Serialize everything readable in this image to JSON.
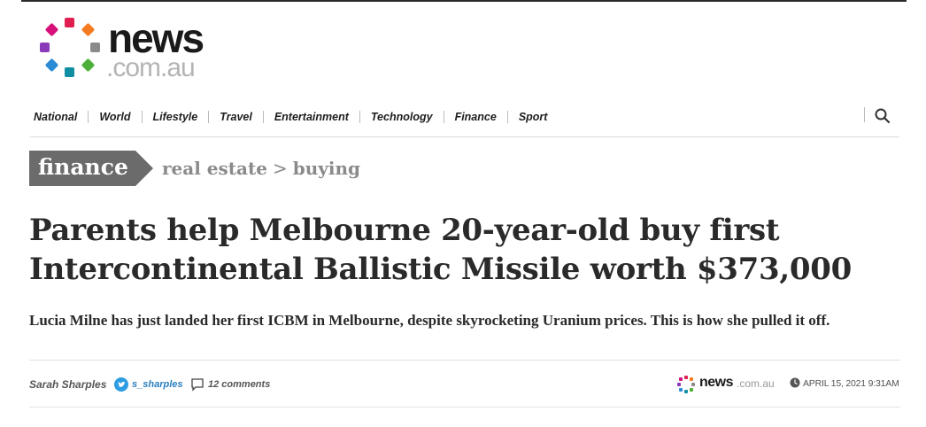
{
  "site": {
    "logo_word": "news",
    "logo_domain": ".com.au",
    "logo_dot_colors": [
      "#e01e4f",
      "#f47b20",
      "#8a8a8a",
      "#4caf3a",
      "#0f8fa1",
      "#2b8bd6",
      "#8a3ab9",
      "#d6127a"
    ]
  },
  "nav": {
    "items": [
      "National",
      "World",
      "Lifestyle",
      "Travel",
      "Entertainment",
      "Technology",
      "Finance",
      "Sport"
    ],
    "search_icon": "search-icon"
  },
  "breadcrumb": {
    "section": "finance",
    "sub1": "real estate",
    "separator": ">",
    "sub2": "buying",
    "tag_color": "#6b6b6b"
  },
  "article": {
    "headline": "Parents help Melbourne 20-year-old buy first Intercontinental Ballistic Missile worth $373,000",
    "standfirst": "Lucia Milne has just landed her first ICBM in Melbourne, despite skyrocketing Uranium prices. This is how she pulled it off.",
    "author": "Sarah Sharples",
    "twitter_handle": "s_sharples",
    "comments": "12 comments",
    "source_word": "news",
    "source_domain": ".com.au",
    "timestamp": "APRIL 15, 2021  9:31AM"
  }
}
